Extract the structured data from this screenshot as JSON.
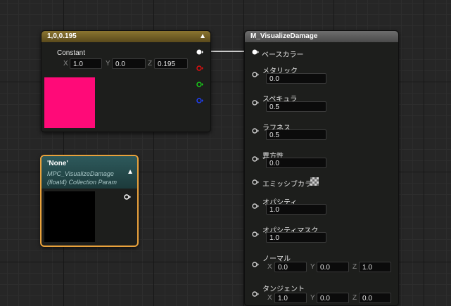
{
  "constant_node": {
    "title": "1,0,0.195",
    "param_label": "Constant",
    "x": {
      "axis": "X",
      "value": "1.0"
    },
    "y": {
      "axis": "Y",
      "value": "0.0"
    },
    "z": {
      "axis": "Z",
      "value": "0.195"
    },
    "preview_color": "#ff0a78",
    "output_pin_colors": [
      "#ffffff",
      "#e21010",
      "#19d019",
      "#2040ff"
    ]
  },
  "collection_node": {
    "title": "'None'",
    "subtitle_line1": "MPC_VisualizeDamage",
    "subtitle_line2": "(float4) Collection Param",
    "border_color": "#e9a23c"
  },
  "material_node": {
    "title": "M_VisualizeDamage",
    "inputs": [
      {
        "label": "ベースカラー",
        "value": null
      },
      {
        "label": "メタリック",
        "value": "0.0"
      },
      {
        "label": "スペキュラ",
        "value": "0.5"
      },
      {
        "label": "ラフネス",
        "value": "0.5"
      },
      {
        "label": "異方性",
        "value": "0.0"
      },
      {
        "label": "エミッシブカラー",
        "value": null
      },
      {
        "label": "オパシティ",
        "value": "1.0"
      },
      {
        "label": "オパシティマスク",
        "value": "1.0"
      },
      {
        "label": "ノーマル",
        "x": {
          "axis": "X",
          "value": "0.0"
        },
        "y": {
          "axis": "Y",
          "value": "0.0"
        },
        "z": {
          "axis": "Z",
          "value": "1.0"
        }
      },
      {
        "label": "タンジェント",
        "x": {
          "axis": "X",
          "value": "1.0"
        },
        "y": {
          "axis": "Y",
          "value": "0.0"
        },
        "z": {
          "axis": "Z",
          "value": "0.0"
        }
      }
    ]
  },
  "chevron_icon": "▲"
}
